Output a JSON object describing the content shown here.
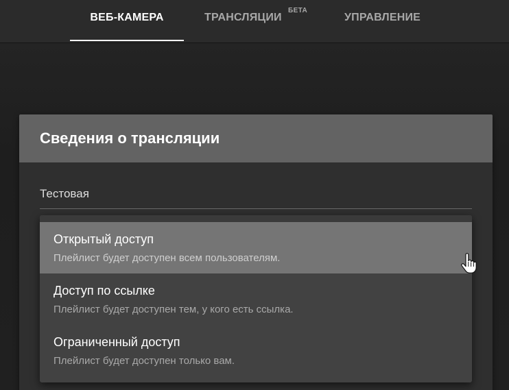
{
  "nav": {
    "tabs": [
      {
        "label": "ВЕБ-КАМЕРА",
        "active": true
      },
      {
        "label": "ТРАНСЛЯЦИИ",
        "active": false,
        "badge": "БЕТА"
      },
      {
        "label": "УПРАВЛЕНИЕ",
        "active": false
      }
    ]
  },
  "card": {
    "title": "Сведения о трансляции",
    "name_field": {
      "value": "Тестовая"
    }
  },
  "privacy_menu": {
    "selected_index": 0,
    "items": [
      {
        "title": "Открытый доступ",
        "description": "Плейлист будет доступен всем пользователям."
      },
      {
        "title": "Доступ по ссылке",
        "description": "Плейлист будет доступен тем, у кого есть ссылка."
      },
      {
        "title": "Ограниченный доступ",
        "description": "Плейлист будет доступен только вам."
      }
    ]
  },
  "colors": {
    "topbar": "#2b2b2b",
    "card_header": "#636363",
    "card_body": "#2f2f2f",
    "menu_bg": "#424242",
    "menu_selected": "#757575",
    "text_primary": "#ffffff",
    "text_secondary": "#a9a9a9"
  },
  "icons": {
    "cursor": "hand-pointer-icon"
  }
}
